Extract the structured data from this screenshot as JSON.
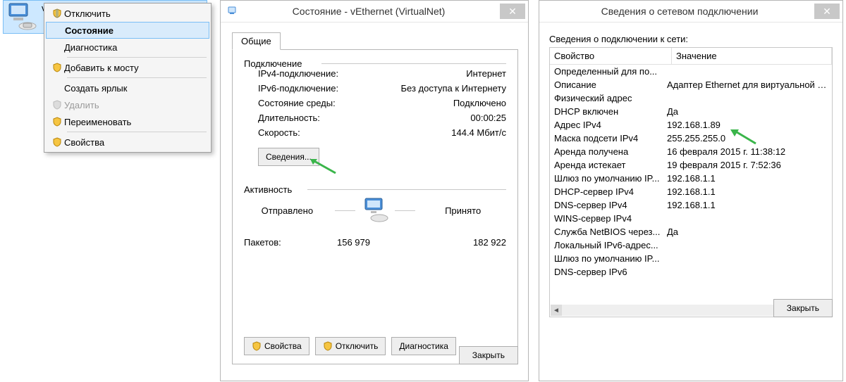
{
  "adapter": {
    "name": "vEthernet (VirtualNet)"
  },
  "ctx": {
    "disable": "Отключить",
    "status": "Состояние",
    "diag": "Диагностика",
    "bridge": "Добавить к мосту",
    "shortcut": "Создать ярлык",
    "delete": "Удалить",
    "rename": "Переименовать",
    "props": "Свойства"
  },
  "status": {
    "title": "Состояние - vEthernet (VirtualNet)",
    "tab_general": "Общие",
    "section_conn": "Подключение",
    "ipv4_label": "IPv4-подключение:",
    "ipv4_value": "Интернет",
    "ipv6_label": "IPv6-подключение:",
    "ipv6_value": "Без доступа к Интернету",
    "media_label": "Состояние среды:",
    "media_value": "Подключено",
    "dur_label": "Длительность:",
    "dur_value": "00:00:25",
    "speed_label": "Скорость:",
    "speed_value": "144.4 Мбит/с",
    "details_btn": "Сведения...",
    "section_activity": "Активность",
    "sent_label": "Отправлено",
    "recv_label": "Принято",
    "packets_label": "Пакетов:",
    "packets_sent": "156 979",
    "packets_recv": "182 922",
    "btn_props": "Свойства",
    "btn_disable": "Отключить",
    "btn_diag": "Диагностика",
    "close": "Закрыть"
  },
  "details": {
    "title": "Сведения о сетевом подключении",
    "caption": "Сведения о подключении к сети:",
    "col_prop": "Свойство",
    "col_val": "Значение",
    "rows": [
      {
        "p": "Определенный для по...",
        "v": ""
      },
      {
        "p": "Описание",
        "v": "Адаптер Ethernet для виртуальной сети"
      },
      {
        "p": "Физический адрес",
        "v": ""
      },
      {
        "p": "DHCP включен",
        "v": "Да"
      },
      {
        "p": "Адрес IPv4",
        "v": "192.168.1.89"
      },
      {
        "p": "Маска подсети IPv4",
        "v": "255.255.255.0"
      },
      {
        "p": "Аренда получена",
        "v": "16 февраля 2015 г. 11:38:12"
      },
      {
        "p": "Аренда истекает",
        "v": "19 февраля 2015 г. 7:52:36"
      },
      {
        "p": "Шлюз по умолчанию IP...",
        "v": "192.168.1.1"
      },
      {
        "p": "DHCP-сервер IPv4",
        "v": "192.168.1.1"
      },
      {
        "p": "DNS-сервер IPv4",
        "v": "192.168.1.1"
      },
      {
        "p": "WINS-сервер IPv4",
        "v": ""
      },
      {
        "p": "Служба NetBIOS через...",
        "v": "Да"
      },
      {
        "p": "Локальный IPv6-адрес...",
        "v": ""
      },
      {
        "p": "Шлюз по умолчанию IP...",
        "v": ""
      },
      {
        "p": "DNS-сервер IPv6",
        "v": ""
      }
    ],
    "close": "Закрыть"
  }
}
